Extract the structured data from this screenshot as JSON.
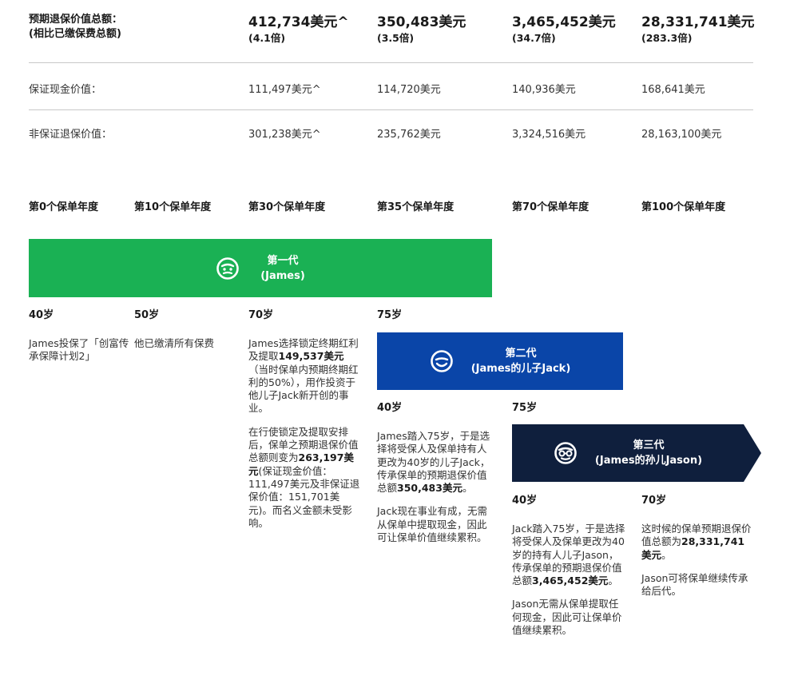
{
  "summary": {
    "label_line1": "预期退保价值总额：",
    "label_line2": "(相比已缴保费总额)",
    "cols": [
      {
        "amount": "412,734美元^",
        "multiple": "(4.1倍)"
      },
      {
        "amount": "350,483美元",
        "multiple": "(3.5倍)"
      },
      {
        "amount": "3,465,452美元",
        "multiple": "(34.7倍)"
      },
      {
        "amount": "28,331,741美元",
        "multiple": "(283.3倍)"
      }
    ]
  },
  "guaranteed": {
    "label": "保证现金价值：",
    "values": [
      "111,497美元^",
      "114,720美元",
      "140,936美元",
      "168,641美元"
    ]
  },
  "non_guaranteed": {
    "label": "非保证退保价值：",
    "values": [
      "301,238美元^",
      "235,762美元",
      "3,324,516美元",
      "28,163,100美元"
    ]
  },
  "years": [
    "第0个保单年度",
    "第10个保单年度",
    "第30个保单年度",
    "第35个保单年度",
    "第70个保单年度",
    "第100个保单年度"
  ],
  "gen1": {
    "title": "第一代",
    "subtitle": "(James)",
    "color": "#1ab154",
    "icon": "face-icon",
    "ages": [
      "40岁",
      "50岁",
      "70岁",
      "75岁"
    ],
    "col0": {
      "t1": "James投保了「创富传承保障计划2」"
    },
    "col1": {
      "t1": "他已缴清所有保费"
    },
    "col2": {
      "t1": "James选择锁定终期红利及提取",
      "b1": "149,537美元",
      "t2": "（当时保单内预期终期红利的50%），用作投资于他儿子Jack新开创的事业。",
      "t3": "在行使锁定及提取安排后，保单之预期退保价值总额则变为",
      "b2": "263,197美元",
      "t4": "(保证现金价值：111,497美元及非保证退保价值：151,701美元)。而名义金额未受影响。"
    }
  },
  "gen2": {
    "title": "第二代",
    "subtitle": "(James的儿子Jack)",
    "color": "#0a45a8",
    "icon": "smile-icon",
    "ages": [
      "40岁",
      "75岁"
    ],
    "text": {
      "t1": "James踏入75岁，于是选择将受保人及保单持有人更改为40岁的儿子Jack，传承保单的预期退保价值总额",
      "b1": "350,483美元",
      "t1_end": "。",
      "t2": "Jack现在事业有成，无需从保单中提取现金，因此可让保单价值继续累积。"
    }
  },
  "gen3": {
    "title": "第三代",
    "subtitle": "(James的孙儿Jason)",
    "color": "#0f1f3d",
    "icon": "glasses-face-icon",
    "ages": [
      "40岁",
      "70岁"
    ],
    "text_a": {
      "t1": "Jack踏入75岁，于是选择将受保人及保单更改为40岁的持有人儿子Jason，传承保单的预期退保价值总额",
      "b1": "3,465,452美元",
      "t1_end": "。",
      "t2": "Jason无需从保单提取任何现金，因此可让保单价值继续累积。"
    },
    "text_b": {
      "t1": "这时候的保单预期退保价值总额为",
      "b1": "28,331,741美元",
      "t1_end": "。",
      "t2": "Jason可将保单继续传承给后代。"
    }
  }
}
